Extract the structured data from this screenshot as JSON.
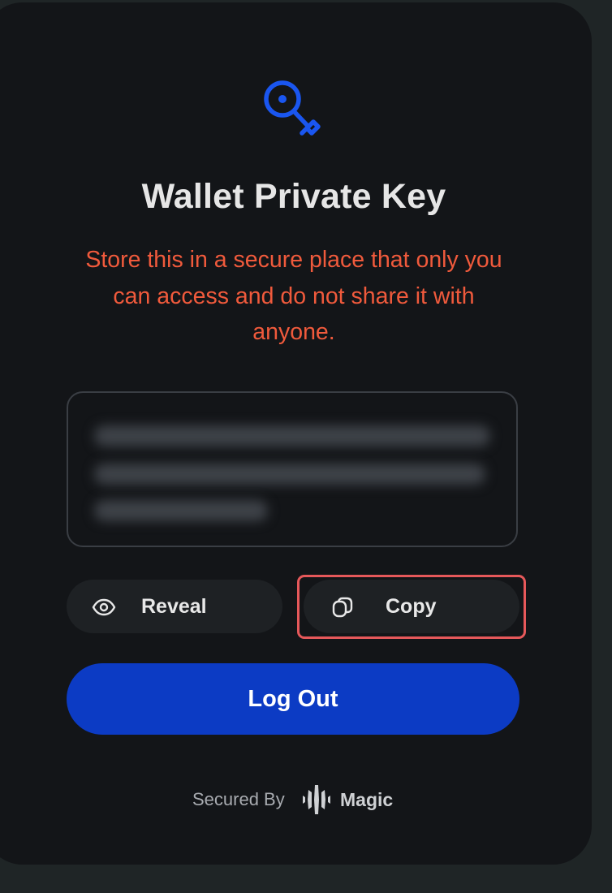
{
  "header": {
    "icon": "key-icon",
    "title": "Wallet Private Key",
    "warning": "Store this in a secure place that only you can access and do not share it with anyone."
  },
  "private_key": {
    "state": "hidden",
    "value": ""
  },
  "actions": {
    "reveal_label": "Reveal",
    "reveal_icon": "eye-icon",
    "copy_label": "Copy",
    "copy_icon": "copy-icon",
    "logout_label": "Log Out"
  },
  "footer": {
    "secured_by": "Secured By",
    "brand": "Magic",
    "brand_icon": "magic-logo-icon"
  },
  "colors": {
    "background": "#131518",
    "accent": "#0c3bc4",
    "warning": "#f05a3c",
    "icon_blue": "#1a56f0",
    "highlight": "#e6585a"
  }
}
